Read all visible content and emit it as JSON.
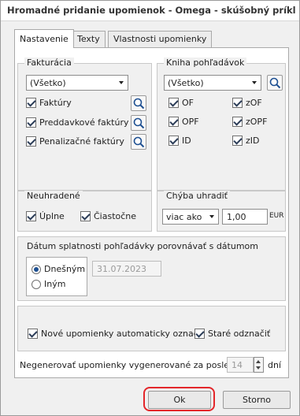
{
  "window": {
    "title": "Hromadné pridanie upomienok - Omega - skúšobný príklad, s.r...."
  },
  "tabs": [
    {
      "label": "Nastavenie"
    },
    {
      "label": "Texty"
    },
    {
      "label": "Vlastnosti upomienky"
    }
  ],
  "fakturacia": {
    "legend": "Fakturácia",
    "select_value": "(Všetko)",
    "items": [
      {
        "label": "Faktúry",
        "checked": true
      },
      {
        "label": "Preddavkové faktúry",
        "checked": true
      },
      {
        "label": "Penalizačné faktúry",
        "checked": true
      }
    ]
  },
  "kniha": {
    "legend": "Kniha pohľadávok",
    "select_value": "(Všetko)",
    "items": [
      {
        "label": "OF",
        "checked": true
      },
      {
        "label": "zOF",
        "checked": true
      },
      {
        "label": "OPF",
        "checked": true
      },
      {
        "label": "zOPF",
        "checked": true
      },
      {
        "label": "ID",
        "checked": true
      },
      {
        "label": "zID",
        "checked": true
      }
    ]
  },
  "neuhradene": {
    "legend": "Neuhradené",
    "uplne": "Úplne",
    "ciastocne": "Čiastočne"
  },
  "chyba": {
    "legend": "Chýba uhradiť",
    "select_value": "viac ako",
    "amount": "1,00",
    "currency": "EUR"
  },
  "datum": {
    "legend": "Dátum splatnosti pohľadávky porovnávať s dátumom",
    "option_today": "Dnešným",
    "option_other": "Iným",
    "date_value": "31.07.2023"
  },
  "options": {
    "auto_mark": "Nové upomienky automaticky označiť",
    "unmark_old": "Staré odznačiť",
    "days_prefix": "Negenerovať upomienky vygenerované za posledných",
    "days_value": "14",
    "days_suffix": "dní"
  },
  "buttons": {
    "ok": "Ok",
    "cancel": "Storno"
  }
}
